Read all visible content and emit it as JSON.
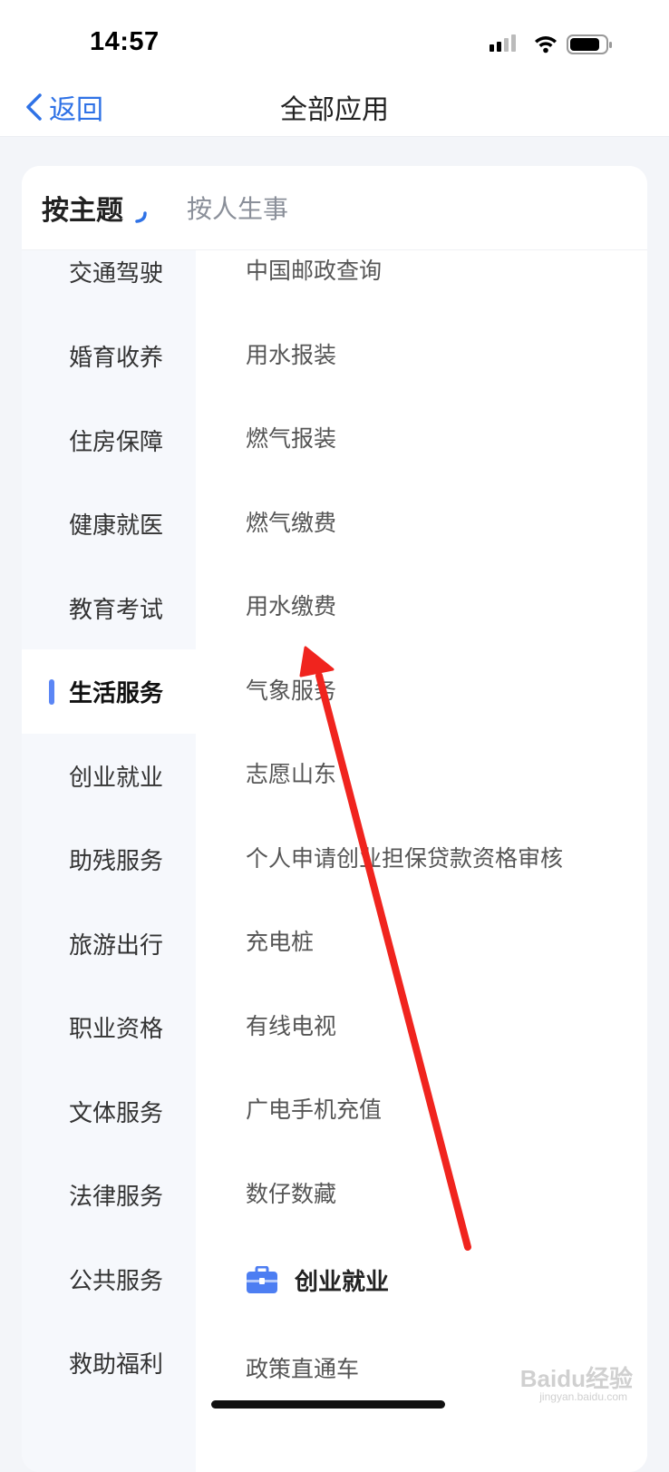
{
  "status_bar": {
    "time": "14:57"
  },
  "nav": {
    "back_label": "返回",
    "title": "全部应用"
  },
  "tabs": {
    "active": "按主题",
    "inactive": "按人生事"
  },
  "sidebar": {
    "items": [
      {
        "label": "交通驾驶"
      },
      {
        "label": "婚育收养"
      },
      {
        "label": "住房保障"
      },
      {
        "label": "健康就医"
      },
      {
        "label": "教育考试"
      },
      {
        "label": "生活服务",
        "active": true
      },
      {
        "label": "创业就业"
      },
      {
        "label": "助残服务"
      },
      {
        "label": "旅游出行"
      },
      {
        "label": "职业资格"
      },
      {
        "label": "文体服务"
      },
      {
        "label": "法律服务"
      },
      {
        "label": "公共服务"
      },
      {
        "label": "救助福利"
      }
    ]
  },
  "services": [
    "中国邮政查询",
    "用水报装",
    "燃气报装",
    "燃气缴费",
    "用水缴费",
    "气象服务",
    "志愿山东",
    "个人申请创业担保贷款资格审核",
    "充电桩",
    "有线电视",
    "广电手机充值",
    "数仔数藏"
  ],
  "section": {
    "title": "创业就业",
    "icon": "briefcase-icon",
    "items": [
      "政策直通车"
    ]
  },
  "colors": {
    "accent": "#2f72e6",
    "indicator": "#5b86f5",
    "annotation": "#f0241e"
  },
  "watermark": {
    "brand": "Baidu经验",
    "url": "jingyan.baidu.com"
  }
}
